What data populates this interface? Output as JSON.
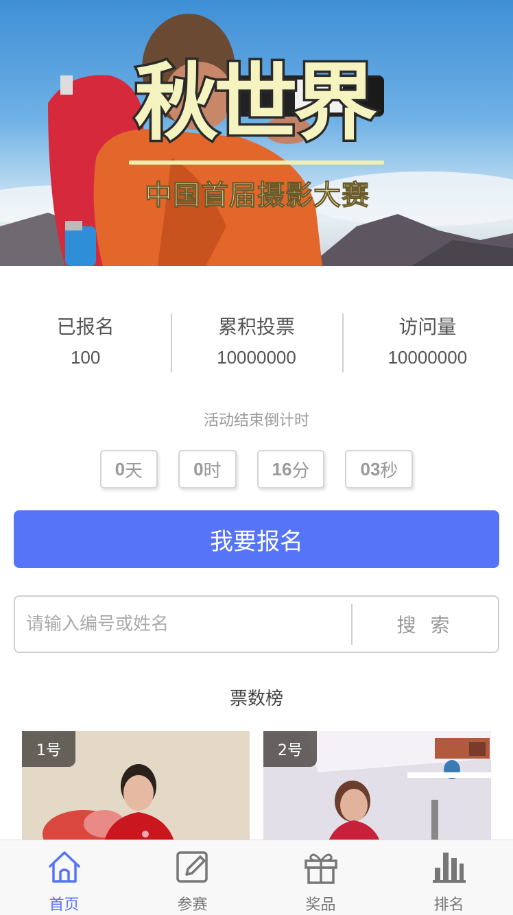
{
  "banner": {
    "title": "秋世界",
    "subtitle": "中国首届摄影大赛"
  },
  "stats": [
    {
      "label": "已报名",
      "value": "100"
    },
    {
      "label": "累积投票",
      "value": "10000000"
    },
    {
      "label": "访问量",
      "value": "10000000"
    }
  ],
  "countdown": {
    "title": "活动结束倒计时",
    "days": "0",
    "days_unit": "天",
    "hours": "0",
    "hours_unit": "时",
    "minutes": "16",
    "minutes_unit": "分",
    "seconds": "03",
    "seconds_unit": "秒"
  },
  "signup_button": "我要报名",
  "search": {
    "placeholder": "请输入编号或姓名",
    "button": "搜 索"
  },
  "ranking": {
    "title": "票数榜",
    "entries": [
      {
        "badge": "1号"
      },
      {
        "badge": "2号"
      }
    ]
  },
  "tabbar": {
    "active_color": "#5674f7",
    "items": [
      {
        "label": "首页",
        "icon": "home-icon",
        "active": true
      },
      {
        "label": "参赛",
        "icon": "edit-icon"
      },
      {
        "label": "奖品",
        "icon": "gift-icon"
      },
      {
        "label": "排名",
        "icon": "bar-chart-icon"
      }
    ]
  },
  "colors": {
    "primary": "#5674f7",
    "text": "#555555",
    "muted": "#999999"
  }
}
